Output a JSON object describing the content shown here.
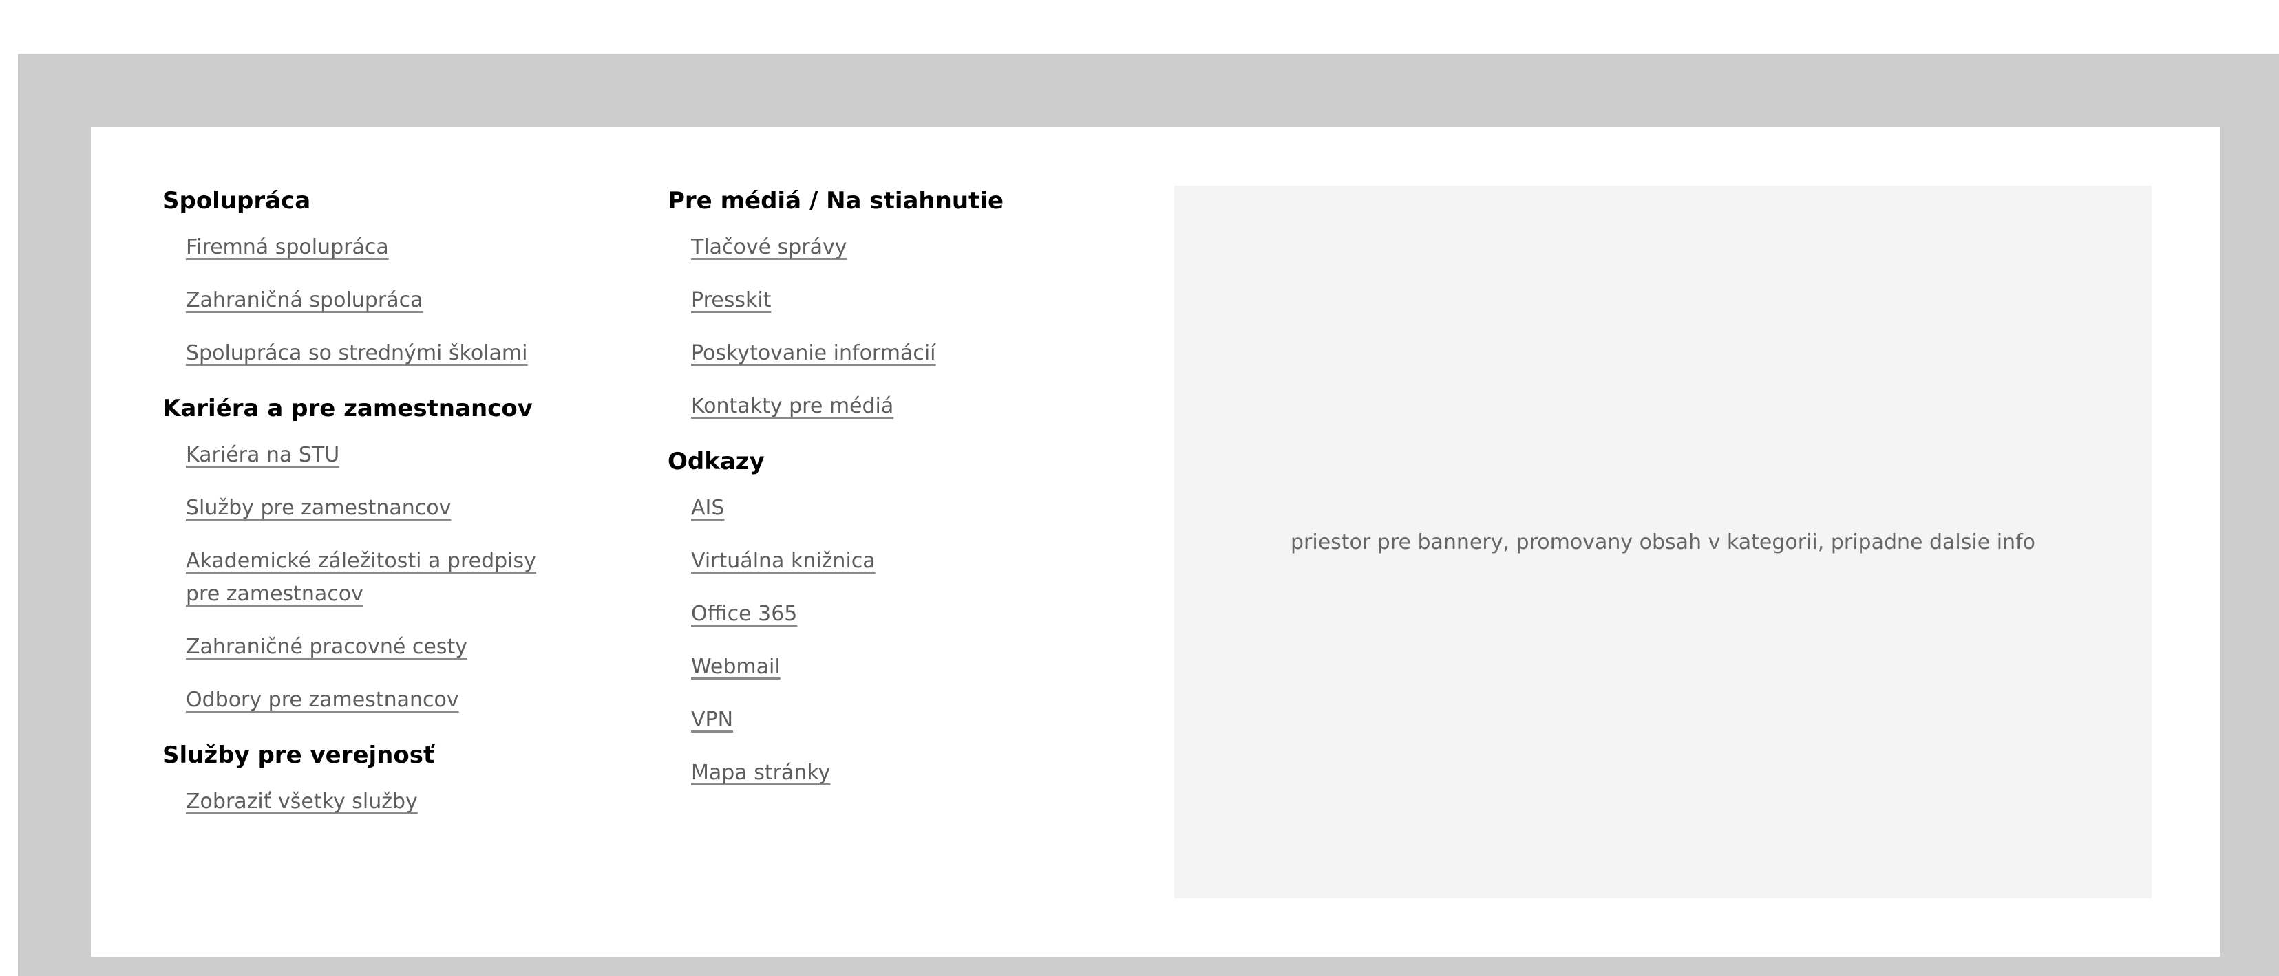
{
  "footer": {
    "columns": [
      {
        "sections": [
          {
            "title": "Spolupráca",
            "links": [
              "Firemná spolupráca",
              "Zahraničná spolupráca",
              "Spolupráca so strednými školami"
            ]
          },
          {
            "title": "Kariéra a pre zamestnancov",
            "links": [
              "Kariéra na STU",
              "Služby pre zamestnancov",
              "Akademické záležitosti a predpisy pre zamestnacov",
              "Zahraničné pracovné cesty",
              "Odbory pre zamestnancov"
            ]
          },
          {
            "title": "Služby pre verejnosť",
            "links": [
              "Zobraziť všetky služby"
            ]
          }
        ]
      },
      {
        "sections": [
          {
            "title": "Pre médiá / Na stiahnutie",
            "links": [
              "Tlačové správy",
              "Presskit",
              "Poskytovanie informácií",
              "Kontakty pre médiá"
            ]
          },
          {
            "title": "Odkazy",
            "links": [
              "AIS",
              "Virtuálna knižnica",
              "Office 365",
              "Webmail",
              "VPN",
              "Mapa stránky"
            ]
          }
        ]
      }
    ],
    "banner": {
      "text": "priestor pre bannery, promovany obsah v kategorii, pripadne dalsie info"
    }
  },
  "colors": {
    "outer_panel": "#cccccc",
    "inner_panel": "#ffffff",
    "banner_bg": "#f4f4f4",
    "link_text": "#5e5e5e",
    "heading_text": "#000000"
  }
}
